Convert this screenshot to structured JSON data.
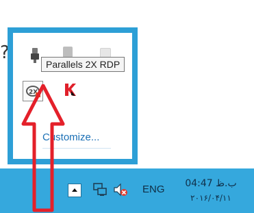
{
  "backdrop": {
    "fragment_text": "? o"
  },
  "flyout": {
    "tooltip": "Parallels 2X RDP",
    "customize_link": "Customize...",
    "icons": {
      "rdp": "parallels-2x-rdp-icon",
      "kaspersky": "kaspersky-icon"
    }
  },
  "taskbar": {
    "language": "ENG",
    "time": "04:47 ب.ظ",
    "date": "۲۰۱۶/۰۴/۱۱",
    "icons": [
      "show-hidden-icons-button",
      "network-icon",
      "volume-muted-icon"
    ]
  },
  "colors": {
    "taskbar": "#35a8dd",
    "flyout_border": "#2d9fd6",
    "arrow": "#e4202a",
    "link": "#1a6fb5"
  }
}
